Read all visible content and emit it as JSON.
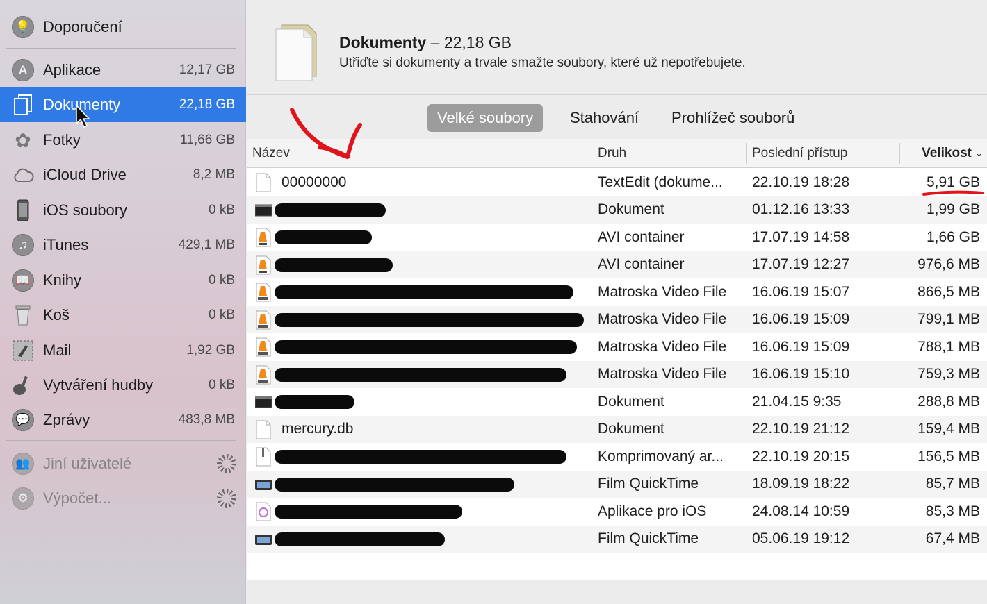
{
  "sidebar": {
    "items": [
      {
        "label": "Doporučení",
        "size": "",
        "icon": "recommendations-icon"
      },
      {
        "label": "Aplikace",
        "size": "12,17 GB",
        "icon": "apps-icon"
      },
      {
        "label": "Dokumenty",
        "size": "22,18 GB",
        "icon": "documents-icon",
        "selected": true
      },
      {
        "label": "Fotky",
        "size": "11,66 GB",
        "icon": "photos-icon"
      },
      {
        "label": "iCloud Drive",
        "size": "8,2 MB",
        "icon": "cloud-icon"
      },
      {
        "label": "iOS soubory",
        "size": "0 kB",
        "icon": "phone-icon"
      },
      {
        "label": "iTunes",
        "size": "429,1 MB",
        "icon": "music-icon"
      },
      {
        "label": "Knihy",
        "size": "0 kB",
        "icon": "book-icon"
      },
      {
        "label": "Koš",
        "size": "0 kB",
        "icon": "trash-icon"
      },
      {
        "label": "Mail",
        "size": "1,92 GB",
        "icon": "mail-icon"
      },
      {
        "label": "Vytváření hudby",
        "size": "0 kB",
        "icon": "guitar-icon"
      },
      {
        "label": "Zprávy",
        "size": "483,8 MB",
        "icon": "messages-icon"
      }
    ],
    "other_users": "Jiní uživatelé",
    "computing": "Výpočet..."
  },
  "header": {
    "title": "Dokumenty",
    "title_size": " – 22,18 GB",
    "subtitle": "Utřiďte si dokumenty a trvale smažte soubory, které už nepotřebujete."
  },
  "tabs": [
    {
      "label": "Velké soubory",
      "active": true
    },
    {
      "label": "Stahování",
      "active": false
    },
    {
      "label": "Prohlížeč souborů",
      "active": false
    }
  ],
  "table": {
    "columns": {
      "name": "Název",
      "kind": "Druh",
      "last_access": "Poslední přístup",
      "size": "Velikost"
    },
    "rows": [
      {
        "name": "00000000",
        "kind": "TextEdit (dokume...",
        "date": "22.10.19 18:28",
        "size": "5,91 GB",
        "icon": "blank-doc-icon",
        "redacted": false
      },
      {
        "name": "",
        "kind": "Dokument",
        "date": "01.12.16 13:33",
        "size": "1,99 GB",
        "icon": "terminal-doc-icon",
        "redacted": true
      },
      {
        "name": "",
        "kind": "AVI container",
        "date": "17.07.19 14:58",
        "size": "1,66 GB",
        "icon": "vlc-avi-icon",
        "redacted": true
      },
      {
        "name": "",
        "kind": "AVI container",
        "date": "17.07.19 12:27",
        "size": "976,6 MB",
        "icon": "vlc-avi-icon",
        "redacted": true
      },
      {
        "name": "",
        "kind": "Matroska Video File",
        "date": "16.06.19 15:07",
        "size": "866,5 MB",
        "icon": "vlc-mkv-icon",
        "redacted": true
      },
      {
        "name": "",
        "kind": "Matroska Video File",
        "date": "16.06.19 15:09",
        "size": "799,1 MB",
        "icon": "vlc-mkv-icon",
        "redacted": true
      },
      {
        "name": "",
        "kind": "Matroska Video File",
        "date": "16.06.19 15:09",
        "size": "788,1 MB",
        "icon": "vlc-mkv-icon",
        "redacted": true
      },
      {
        "name": "",
        "kind": "Matroska Video File",
        "date": "16.06.19 15:10",
        "size": "759,3 MB",
        "icon": "vlc-mkv-icon",
        "redacted": true
      },
      {
        "name": "",
        "kind": "Dokument",
        "date": "21.04.15 9:35",
        "size": "288,8 MB",
        "icon": "terminal-doc-icon",
        "redacted": true
      },
      {
        "name": "mercury.db",
        "kind": "Dokument",
        "date": "22.10.19 21:12",
        "size": "159,4 MB",
        "icon": "blank-doc-icon",
        "redacted": false
      },
      {
        "name": "",
        "kind": "Komprimovaný ar...",
        "date": "22.10.19 20:15",
        "size": "156,5 MB",
        "icon": "archive-icon",
        "redacted": true
      },
      {
        "name": "",
        "kind": "Film QuickTime",
        "date": "18.09.19 18:22",
        "size": "85,7 MB",
        "icon": "quicktime-icon",
        "redacted": true
      },
      {
        "name": "",
        "kind": "Aplikace pro iOS",
        "date": "24.08.14 10:59",
        "size": "85,3 MB",
        "icon": "itunes-app-icon",
        "redacted": true
      },
      {
        "name": "",
        "kind": "Film QuickTime",
        "date": "05.06.19 19:12",
        "size": "67,4 MB",
        "icon": "quicktime-icon",
        "redacted": true
      }
    ]
  },
  "colors": {
    "selection": "#2f7ae5",
    "annotation_red": "#e0141b"
  }
}
